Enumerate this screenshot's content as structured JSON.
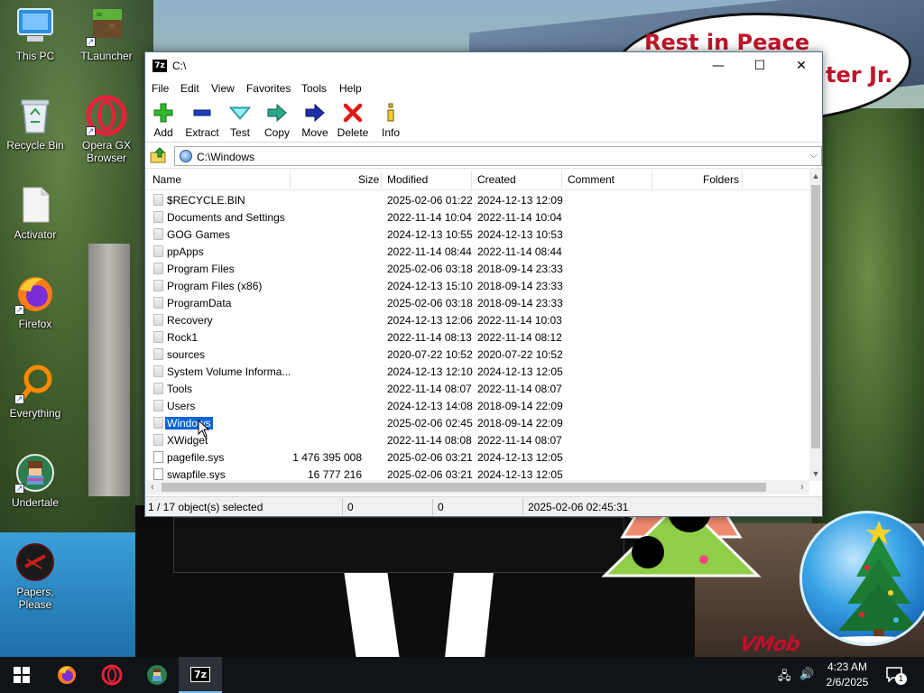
{
  "wallpaper": {
    "bubble_line1": "Rest in Peace",
    "bubble_line2": "ter Jr.",
    "watermark": "VMob"
  },
  "desktop_icons": [
    {
      "label": "This PC",
      "icon": "computer-icon"
    },
    {
      "label": "TLauncher",
      "icon": "tlauncher-icon"
    },
    {
      "label": "Recycle Bin",
      "icon": "recycle-bin-icon"
    },
    {
      "label": "Opera GX Browser",
      "icon": "opera-gx-icon"
    },
    {
      "label": "Activator",
      "icon": "file-icon"
    },
    {
      "label": "Firefox",
      "icon": "firefox-icon"
    },
    {
      "label": "Everything",
      "icon": "everything-search-icon"
    },
    {
      "label": "Undertale",
      "icon": "undertale-icon"
    },
    {
      "label": "Papers, Please",
      "icon": "papers-please-icon"
    }
  ],
  "window": {
    "app_icon_text": "7z",
    "title": "C:\\",
    "minimize": "—",
    "maximize": "☐",
    "close": "✕",
    "menu": [
      "File",
      "Edit",
      "View",
      "Favorites",
      "Tools",
      "Help"
    ],
    "toolbar": {
      "add": "Add",
      "extract": "Extract",
      "test": "Test",
      "copy": "Copy",
      "move": "Move",
      "delete": "Delete",
      "info": "Info"
    },
    "address": "C:\\Windows",
    "columns": {
      "name": "Name",
      "size": "Size",
      "modified": "Modified",
      "created": "Created",
      "comment": "Comment",
      "folders": "Folders"
    },
    "rows": [
      {
        "name": "$RECYCLE.BIN",
        "size": "",
        "modified": "2025-02-06 01:22",
        "created": "2024-12-13 12:09",
        "type": "folder"
      },
      {
        "name": "Documents and Settings",
        "size": "",
        "modified": "2022-11-14 10:04",
        "created": "2022-11-14 10:04",
        "type": "folder"
      },
      {
        "name": "GOG Games",
        "size": "",
        "modified": "2024-12-13 10:55",
        "created": "2024-12-13 10:53",
        "type": "folder"
      },
      {
        "name": "ppApps",
        "size": "",
        "modified": "2022-11-14 08:44",
        "created": "2022-11-14 08:44",
        "type": "folder"
      },
      {
        "name": "Program Files",
        "size": "",
        "modified": "2025-02-06 03:18",
        "created": "2018-09-14 23:33",
        "type": "folder"
      },
      {
        "name": "Program Files (x86)",
        "size": "",
        "modified": "2024-12-13 15:10",
        "created": "2018-09-14 23:33",
        "type": "folder"
      },
      {
        "name": "ProgramData",
        "size": "",
        "modified": "2025-02-06 03:18",
        "created": "2018-09-14 23:33",
        "type": "folder"
      },
      {
        "name": "Recovery",
        "size": "",
        "modified": "2024-12-13 12:06",
        "created": "2022-11-14 10:03",
        "type": "folder"
      },
      {
        "name": "Rock1",
        "size": "",
        "modified": "2022-11-14 08:13",
        "created": "2022-11-14 08:12",
        "type": "folder"
      },
      {
        "name": "sources",
        "size": "",
        "modified": "2020-07-22 10:52",
        "created": "2020-07-22 10:52",
        "type": "folder"
      },
      {
        "name": "System Volume Informa...",
        "size": "",
        "modified": "2024-12-13 12:10",
        "created": "2024-12-13 12:05",
        "type": "folder"
      },
      {
        "name": "Tools",
        "size": "",
        "modified": "2022-11-14 08:07",
        "created": "2022-11-14 08:07",
        "type": "folder"
      },
      {
        "name": "Users",
        "size": "",
        "modified": "2024-12-13 14:08",
        "created": "2018-09-14 22:09",
        "type": "folder"
      },
      {
        "name": "Windows",
        "size": "",
        "modified": "2025-02-06 02:45",
        "created": "2018-09-14 22:09",
        "type": "folder",
        "selected": true
      },
      {
        "name": "XWidget",
        "size": "",
        "modified": "2022-11-14 08:08",
        "created": "2022-11-14 08:07",
        "type": "folder"
      },
      {
        "name": "pagefile.sys",
        "size": "1 476 395 008",
        "modified": "2025-02-06 03:21",
        "created": "2024-12-13 12:05",
        "type": "file"
      },
      {
        "name": "swapfile.sys",
        "size": "16 777 216",
        "modified": "2025-02-06 03:21",
        "created": "2024-12-13 12:05",
        "type": "file"
      }
    ],
    "status": {
      "selection": "1 / 17 object(s) selected",
      "size": "0",
      "packed": "0",
      "datetime": "2025-02-06 02:45:31"
    }
  },
  "taskbar": {
    "apps": [
      "windows-start-icon",
      "firefox-icon",
      "opera-gx-icon",
      "undertale-icon",
      "seven-zip-icon"
    ],
    "active_app_label": "7z",
    "time": "4:23 AM",
    "date": "2/6/2025",
    "notification_count": "1"
  }
}
